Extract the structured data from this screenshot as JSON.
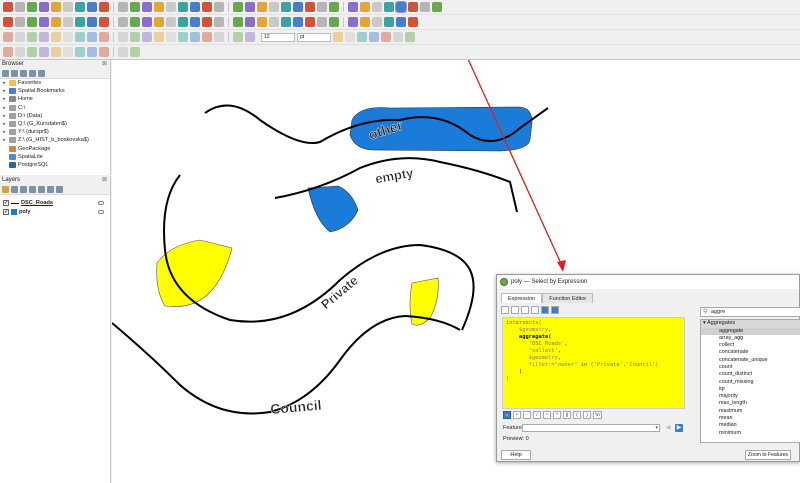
{
  "toolbars": {
    "row1": [
      "folder-open",
      "save",
      "save-as",
      "print",
      "layout",
      "style",
      "pan",
      "pan-to-selection",
      "zoom-in",
      "zoom-out",
      "zoom-full",
      "zoom-selection",
      "zoom-layer",
      "zoom-native",
      "zoom-last",
      "zoom-next",
      "new-map-view",
      "new-3d-view",
      "bookmark",
      "show-bookmarks",
      "refresh",
      "time-controller",
      "identify",
      "attribute-table",
      "field-calc",
      "stats",
      "toolbox",
      "open-table",
      "measure",
      "annotate",
      "tips",
      "select-by-expression",
      "select-dropdown",
      "deselect",
      "filter"
    ],
    "row2": [
      "add-vector",
      "add-raster",
      "add-wms",
      "add-virtual",
      "add-csv",
      "add-spatialite",
      "add-postgis",
      "add-wfs",
      "new-layer",
      "new-shp",
      "new-temp",
      "digitize",
      "edit",
      "save-edits",
      "add-feature",
      "move",
      "vertex",
      "delete",
      "cut",
      "copy",
      "paste",
      "undo",
      "redo",
      "label",
      "pin",
      "rotate",
      "change-label",
      "show-labels",
      "python",
      "plugin-a",
      "plugin-b",
      "plugin-c",
      "plugin-d"
    ],
    "row3": [
      "snap",
      "trace",
      "advanced",
      "split",
      "merge",
      "offset",
      "reshape",
      "fill-ring",
      "del-ring",
      "del-part",
      "simplify",
      "ring",
      "reverse",
      "rotate-feature",
      "scale",
      "offset-curve",
      "move",
      "text-a",
      "layer-b",
      "color",
      "tool",
      "tool2",
      "font-size",
      "units",
      "tool3",
      "tool4",
      "x"
    ],
    "row4": [
      "select",
      "select-a",
      "select-b",
      "select-c",
      "label-a",
      "label-b",
      "label-c",
      "label-d",
      "label-e",
      "label-f",
      "label-g"
    ],
    "font_size_value": "12",
    "units_value": "pt"
  },
  "browser": {
    "title": "Browser",
    "items": [
      {
        "label": "Favorites",
        "icon": "star-icon"
      },
      {
        "label": "Spatial Bookmarks",
        "icon": "bookmark-icon"
      },
      {
        "label": "Home",
        "icon": "home-icon"
      },
      {
        "label": "C:\\",
        "icon": "drive-icon"
      },
      {
        "label": "D:\\ (Data)",
        "icon": "drive-icon"
      },
      {
        "label": "Q:\\ (G_Kursdaten$)",
        "icon": "drive-icon"
      },
      {
        "label": "Y:\\ (durspr$)",
        "icon": "drive-icon"
      },
      {
        "label": "Z:\\ (G_HIST_b_boskovska$)",
        "icon": "drive-icon"
      },
      {
        "label": "GeoPackage",
        "icon": "geopackage-icon"
      },
      {
        "label": "SpatiaLite",
        "icon": "spatialite-icon"
      },
      {
        "label": "PostgreSQL",
        "icon": "postgresql-icon"
      }
    ]
  },
  "layers": {
    "title": "Layers",
    "items": [
      {
        "label": "DSC_Roads",
        "checked": true
      },
      {
        "label": "poly",
        "checked": true
      }
    ]
  },
  "map": {
    "labels": [
      "other",
      "empty",
      "Private",
      "Council"
    ],
    "polygon_colors": {
      "blue": "#1b7bd8",
      "yellow": "#ffff00"
    }
  },
  "dialog": {
    "title": "poly — Select by Expression",
    "tabs": [
      "Expression",
      "Function Editor"
    ],
    "expression_lines": [
      [
        {
          "t": "intersects(",
          "c": "kw"
        }
      ],
      [
        {
          "t": "    ",
          "c": ""
        },
        {
          "t": "$geometry",
          "c": "fld"
        },
        {
          "t": ",",
          "c": ""
        }
      ],
      [
        {
          "t": "    ",
          "c": ""
        },
        {
          "t": "aggregate(",
          "c": "fn"
        }
      ],
      [
        {
          "t": "       ",
          "c": ""
        },
        {
          "t": "'DSC_Roads'",
          "c": "str"
        },
        {
          "t": ",",
          "c": ""
        }
      ],
      [
        {
          "t": "       ",
          "c": ""
        },
        {
          "t": "'collect'",
          "c": "str"
        },
        {
          "t": ",",
          "c": ""
        }
      ],
      [
        {
          "t": "       ",
          "c": ""
        },
        {
          "t": "$geometry",
          "c": "fld"
        },
        {
          "t": ",",
          "c": ""
        }
      ],
      [
        {
          "t": "       ",
          "c": ""
        },
        {
          "t": "filter:=\"owner\" ",
          "c": "fld"
        },
        {
          "t": "in",
          "c": "op"
        },
        {
          "t": " ('Private','Council')",
          "c": "str"
        }
      ],
      [
        {
          "t": "    )",
          "c": ""
        }
      ],
      [
        {
          "t": ")",
          "c": "kw"
        }
      ]
    ],
    "operators": [
      "=",
      "+",
      "-",
      "/",
      "*",
      "^",
      "||",
      "(",
      ")",
      "'\\n'"
    ],
    "feature_label": "Feature",
    "preview": "Preview:  0",
    "help_label": "Help",
    "zoom_label": "Zoom to Features",
    "search_value": "aggre",
    "function_group": "Aggregates",
    "functions": [
      "aggregate",
      "array_agg",
      "collect",
      "concatenate",
      "concatenate_unique",
      "count",
      "count_distinct",
      "count_missing",
      "iqr",
      "majority",
      "max_length",
      "maximum",
      "mean",
      "median",
      "minimum"
    ]
  }
}
